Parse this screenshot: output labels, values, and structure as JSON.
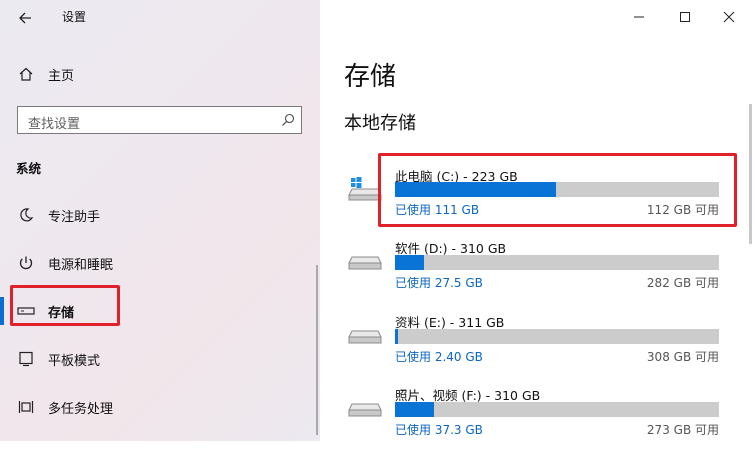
{
  "window": {
    "title": "设置"
  },
  "sidebar": {
    "home_label": "主页",
    "search_placeholder": "查找设置",
    "section_label": "系统",
    "items": [
      {
        "label": "专注助手",
        "icon": "moon-icon"
      },
      {
        "label": "电源和睡眠",
        "icon": "power-icon"
      },
      {
        "label": "存储",
        "icon": "storage-icon",
        "selected": true
      },
      {
        "label": "平板模式",
        "icon": "tablet-icon"
      },
      {
        "label": "多任务处理",
        "icon": "multitask-icon"
      }
    ]
  },
  "main": {
    "title": "存储",
    "subtitle": "本地存储",
    "drives": [
      {
        "name": "此电脑 (C:) - 223 GB",
        "used": "已使用 111 GB",
        "free": "112 GB 可用",
        "fill": 0.497,
        "icon": "windows-drive-icon"
      },
      {
        "name": "软件 (D:) - 310 GB",
        "used": "已使用 27.5 GB",
        "free": "282 GB 可用",
        "fill": 0.089,
        "icon": "drive-icon"
      },
      {
        "name": "资料 (E:) - 311 GB",
        "used": "已使用 2.40 GB",
        "free": "308 GB 可用",
        "fill": 0.008,
        "icon": "drive-icon"
      },
      {
        "name": "照片、视频 (F:) - 310 GB",
        "used": "已使用 37.3 GB",
        "free": "273 GB 可用",
        "fill": 0.12,
        "icon": "drive-icon"
      }
    ]
  },
  "colors": {
    "accent": "#0a74d6",
    "highlight": "#e0202a",
    "bar_track": "#cccccc"
  }
}
